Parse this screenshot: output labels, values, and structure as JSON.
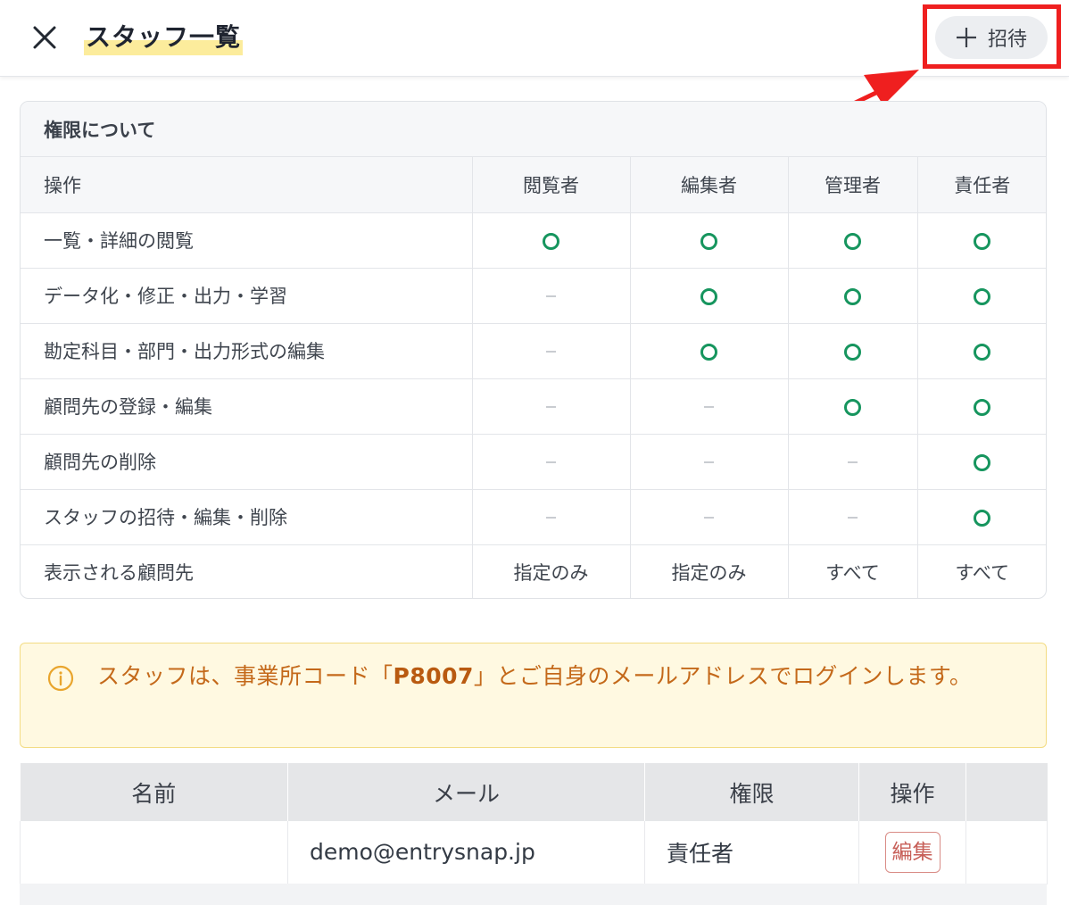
{
  "header": {
    "title": "スタッフ一覧",
    "invite_label": "招待",
    "close_icon": "close-icon",
    "plus_icon": "plus-icon"
  },
  "permissions": {
    "title": "権限について",
    "columns": [
      "操作",
      "閲覧者",
      "編集者",
      "管理者",
      "責任者"
    ],
    "rows": [
      {
        "label": "一覧・詳細の閲覧",
        "cells": [
          "yes",
          "yes",
          "yes",
          "yes"
        ]
      },
      {
        "label": "データ化・修正・出力・学習",
        "cells": [
          "no",
          "yes",
          "yes",
          "yes"
        ]
      },
      {
        "label": "勘定科目・部門・出力形式の編集",
        "cells": [
          "no",
          "yes",
          "yes",
          "yes"
        ]
      },
      {
        "label": "顧問先の登録・編集",
        "cells": [
          "no",
          "no",
          "yes",
          "yes"
        ]
      },
      {
        "label": "顧問先の削除",
        "cells": [
          "no",
          "no",
          "no",
          "yes"
        ]
      },
      {
        "label": "スタッフの招待・編集・削除",
        "cells": [
          "no",
          "no",
          "no",
          "yes"
        ]
      },
      {
        "label": "表示される顧問先",
        "cells": [
          "指定のみ",
          "指定のみ",
          "すべて",
          "すべて"
        ]
      }
    ]
  },
  "notice": {
    "text_before": "スタッフは、事業所コード「",
    "office_code": "P8007",
    "text_after": "」とご自身のメールアドレスでログインします。",
    "icon": "info-icon"
  },
  "staff_table": {
    "columns": [
      "名前",
      "メール",
      "権限",
      "操作",
      ""
    ],
    "rows": [
      {
        "name": "",
        "email": "demo@entrysnap.jp",
        "role": "責任者",
        "action_label": "編集"
      }
    ]
  },
  "colors": {
    "highlight_border": "#ef1f1f",
    "check_green": "#16955e",
    "notice_text": "#c4691a",
    "title_marker": "#fcec9c"
  }
}
